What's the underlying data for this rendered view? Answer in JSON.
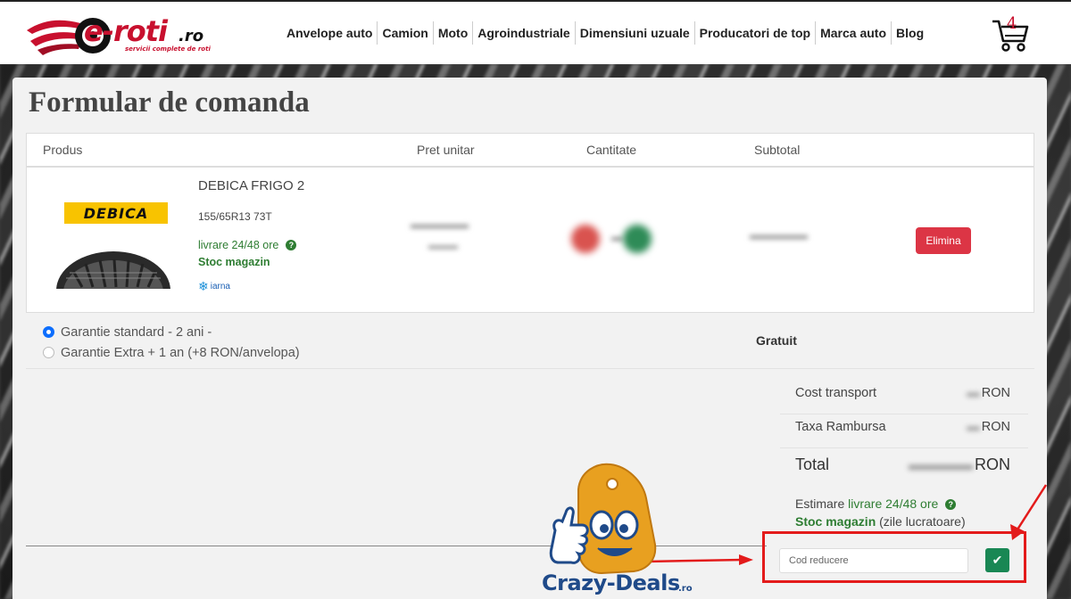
{
  "header": {
    "logo_text": "e-roti",
    "logo_tld": ".ro",
    "logo_tagline": "servicii complete de roti",
    "nav": [
      "Anvelope auto",
      "Camion",
      "Moto",
      "Agroindustriale",
      "Dimensiuni uzuale",
      "Producatori de top",
      "Marca auto",
      "Blog"
    ],
    "cart_count": "4"
  },
  "page": {
    "title": "Formular de comanda"
  },
  "table": {
    "columns": [
      "Produs",
      "Pret unitar",
      "Cantitate",
      "Subtotal"
    ],
    "item": {
      "brand": "DEBICA",
      "name": "DEBICA FRIGO 2",
      "size": "155/65R13 73T",
      "delivery": "livrare 24/48 ore",
      "stock": "Stoc magazin",
      "season": "iarna",
      "delete_label": "Elimina"
    }
  },
  "warranty": {
    "options": [
      {
        "label": "Garantie standard - 2 ani -",
        "selected": true
      },
      {
        "label": "Garantie Extra + 1 an (+8 RON/anvelopa)",
        "selected": false
      }
    ],
    "price": "Gratuit"
  },
  "totals": {
    "rows": [
      {
        "label": "Cost transport",
        "currency": "RON"
      },
      {
        "label": "Taxa Rambursa",
        "currency": "RON"
      }
    ],
    "total_label": "Total",
    "total_currency": "RON"
  },
  "estimate": {
    "prefix": "Estimare",
    "delivery": "livrare 24/48 ore",
    "stock": "Stoc magazin",
    "suffix": "(zile lucratoare)"
  },
  "coupon": {
    "placeholder": "Cod reducere"
  },
  "watermark": {
    "brand": "Crazy-Deals",
    "tld": ".ro"
  },
  "colors": {
    "brand_red": "#c8102e",
    "danger": "#dc3545",
    "success": "#198754",
    "radio_blue": "#0d6efd",
    "highlight_red": "#e31b1b",
    "watermark_orange": "#e8a020",
    "watermark_blue": "#1f4a89"
  }
}
